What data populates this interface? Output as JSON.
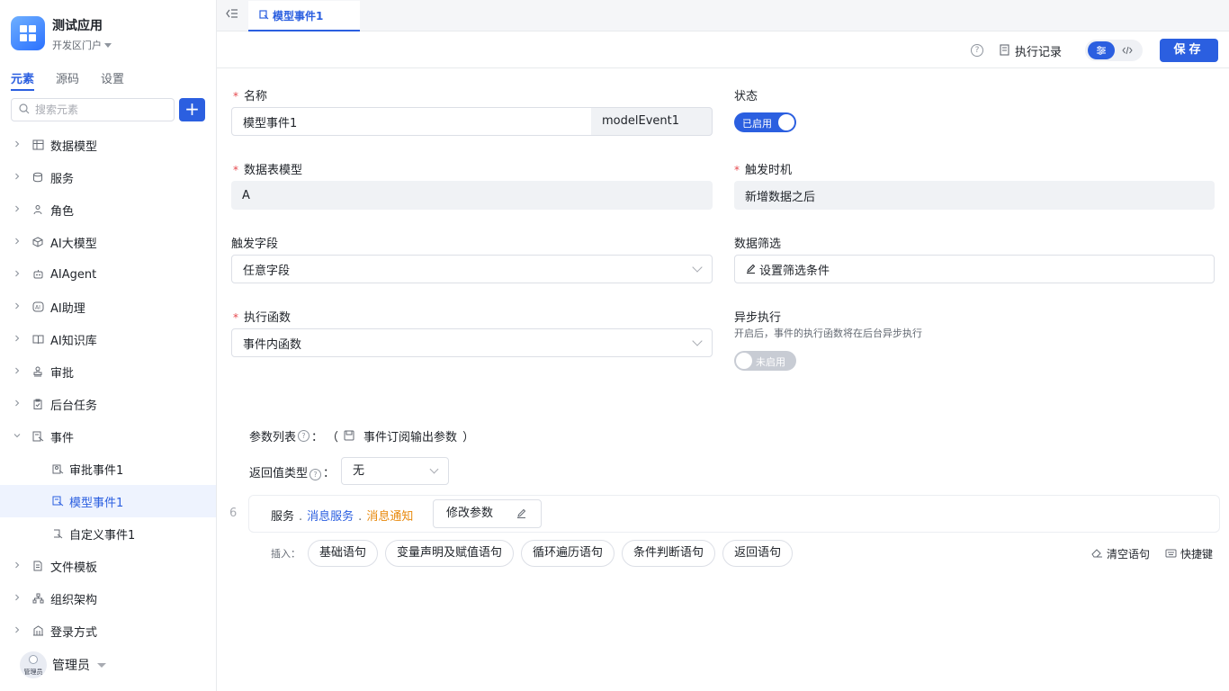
{
  "app": {
    "title": "测试应用",
    "subtitle": "开发区门户"
  },
  "side_tabs": [
    {
      "label": "元素",
      "active": true
    },
    {
      "label": "源码",
      "active": false
    },
    {
      "label": "设置",
      "active": false
    }
  ],
  "search": {
    "placeholder": "搜索元素"
  },
  "tree": [
    {
      "label": "数据模型",
      "icon": "table-icon"
    },
    {
      "label": "服务",
      "icon": "database-icon"
    },
    {
      "label": "角色",
      "icon": "user-group-icon"
    },
    {
      "label": "AI大模型",
      "icon": "cube-icon"
    },
    {
      "label": "AIAgent",
      "icon": "robot-icon"
    },
    {
      "label": "AI助理",
      "icon": "ai-assistant-icon"
    },
    {
      "label": "AI知识库",
      "icon": "book-icon"
    },
    {
      "label": "审批",
      "icon": "stamp-icon"
    },
    {
      "label": "后台任务",
      "icon": "clipboard-icon"
    },
    {
      "label": "事件",
      "icon": "event-icon",
      "expanded": true
    },
    {
      "label": "审批事件1",
      "icon": "approval-event-icon",
      "child": true
    },
    {
      "label": "模型事件1",
      "icon": "model-event-icon",
      "child": true,
      "selected": true
    },
    {
      "label": "自定义事件1",
      "icon": "custom-event-icon",
      "child": true
    },
    {
      "label": "文件模板",
      "icon": "file-icon"
    },
    {
      "label": "组织架构",
      "icon": "org-icon"
    },
    {
      "label": "登录方式",
      "icon": "login-icon"
    }
  ],
  "user": {
    "name": "管理员",
    "avatar_tag": "管理员"
  },
  "tab": {
    "label": "模型事件1"
  },
  "toolbar": {
    "exec_log": "执行记录",
    "save": "保存"
  },
  "form": {
    "name_label": "名称",
    "name_value": "模型事件1",
    "name_key": "modelEvent1",
    "status_label": "状态",
    "status_value": "已启用",
    "table_model_label": "数据表模型",
    "table_model_value": "A",
    "trigger_time_label": "触发时机",
    "trigger_time_value": "新增数据之后",
    "trigger_field_label": "触发字段",
    "trigger_field_value": "任意字段",
    "filter_label": "数据筛选",
    "filter_value": "设置筛选条件",
    "exec_fn_label": "执行函数",
    "exec_fn_value": "事件内函数",
    "async_label": "异步执行",
    "async_hint": "开启后，事件的执行函数将在后台异步执行",
    "async_value": "未启用"
  },
  "params": {
    "label": "参数列表",
    "colon": "：",
    "open_paren": "（",
    "output_params": "事件订阅输出参数",
    "close_paren": "）",
    "return_label": "返回值类型",
    "return_value": "无"
  },
  "code": {
    "line_no": "6",
    "service": "服务",
    "msg_service": "消息服务",
    "msg_notify": "消息通知",
    "edit_params": "修改参数"
  },
  "insert": {
    "label": "插入：",
    "chips": [
      "基础语句",
      "变量声明及赋值语句",
      "循环遍历语句",
      "条件判断语句",
      "返回语句"
    ],
    "clear": "清空语句",
    "shortcut": "快捷键"
  },
  "colors": {
    "primary": "#2b5fe0",
    "orange": "#e8890c",
    "required": "#e5484d"
  }
}
